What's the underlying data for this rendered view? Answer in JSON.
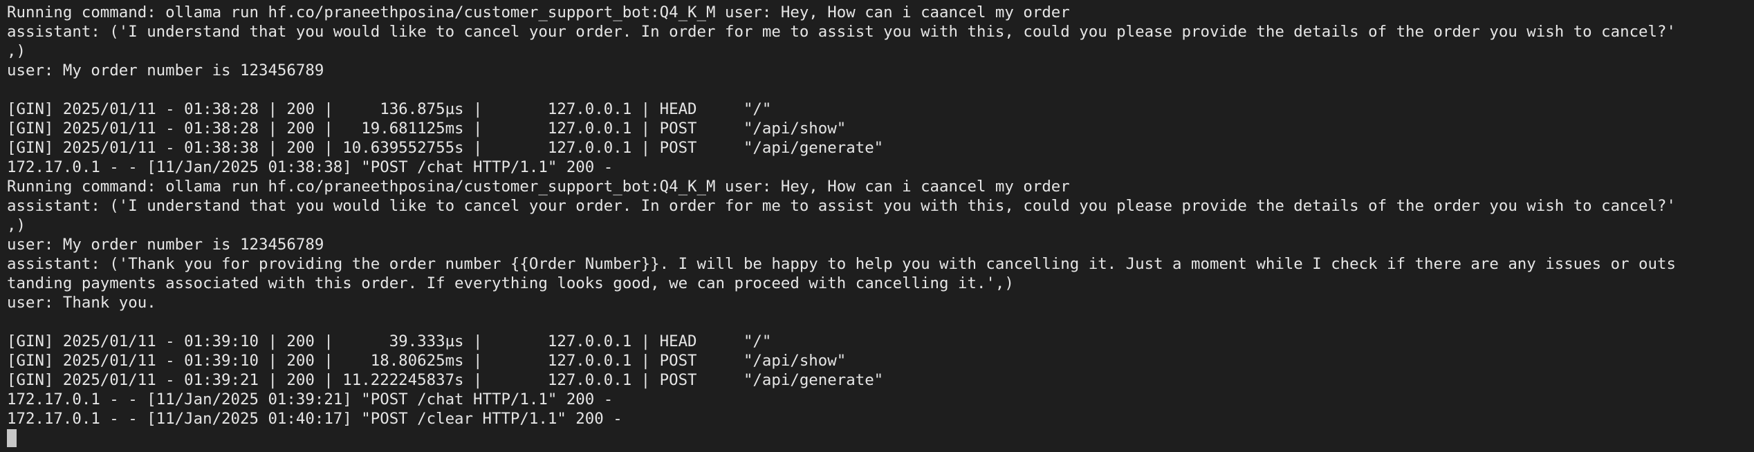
{
  "terminal": {
    "lines": [
      "Running command: ollama run hf.co/praneethposina/customer_support_bot:Q4_K_M user: Hey, How can i caancel my order",
      "assistant: ('I understand that you would like to cancel your order. In order for me to assist you with this, could you please provide the details of the order you wish to cancel?'",
      ",)",
      "user: My order number is 123456789",
      "",
      "[GIN] 2025/01/11 - 01:38:28 | 200 |     136.875µs |       127.0.0.1 | HEAD     \"/\"",
      "[GIN] 2025/01/11 - 01:38:28 | 200 |   19.681125ms |       127.0.0.1 | POST     \"/api/show\"",
      "[GIN] 2025/01/11 - 01:38:38 | 200 | 10.639552755s |       127.0.0.1 | POST     \"/api/generate\"",
      "172.17.0.1 - - [11/Jan/2025 01:38:38] \"POST /chat HTTP/1.1\" 200 -",
      "Running command: ollama run hf.co/praneethposina/customer_support_bot:Q4_K_M user: Hey, How can i caancel my order",
      "assistant: ('I understand that you would like to cancel your order. In order for me to assist you with this, could you please provide the details of the order you wish to cancel?'",
      ",)",
      "user: My order number is 123456789",
      "assistant: ('Thank you for providing the order number {{Order Number}}. I will be happy to help you with cancelling it. Just a moment while I check if there are any issues or outs",
      "tanding payments associated with this order. If everything looks good, we can proceed with cancelling it.',)",
      "user: Thank you.",
      "",
      "[GIN] 2025/01/11 - 01:39:10 | 200 |      39.333µs |       127.0.0.1 | HEAD     \"/\"",
      "[GIN] 2025/01/11 - 01:39:10 | 200 |    18.80625ms |       127.0.0.1 | POST     \"/api/show\"",
      "[GIN] 2025/01/11 - 01:39:21 | 200 | 11.222245837s |       127.0.0.1 | POST     \"/api/generate\"",
      "172.17.0.1 - - [11/Jan/2025 01:39:21] \"POST /chat HTTP/1.1\" 200 -",
      "172.17.0.1 - - [11/Jan/2025 01:40:17] \"POST /clear HTTP/1.1\" 200 -"
    ]
  },
  "colors": {
    "background": "#1e1e1e",
    "foreground": "#e6e6e6",
    "cursor": "#c8c8c8"
  }
}
